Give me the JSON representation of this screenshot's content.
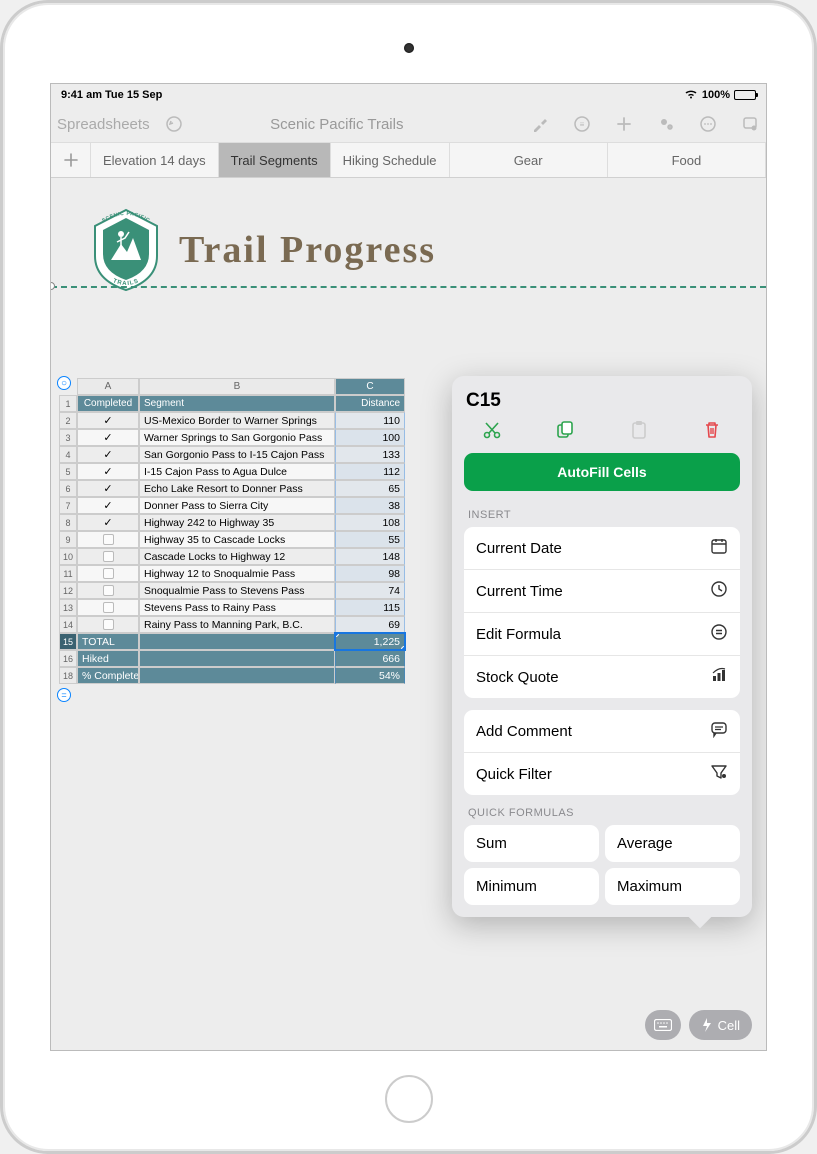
{
  "status": {
    "time_date": "9:41 am  Tue 15 Sep",
    "battery": "100%"
  },
  "toolbar": {
    "back": "Spreadsheets",
    "title": "Scenic Pacific Trails"
  },
  "tabs": [
    "Elevation 14 days",
    "Trail Segments",
    "Hiking Schedule",
    "Gear",
    "Food"
  ],
  "doc": {
    "title": "Trail Progress",
    "logo_upper": "SCENIC PACIFIC",
    "logo_lower": "TRAILS"
  },
  "spreadsheet": {
    "cols": [
      "A",
      "B",
      "C"
    ],
    "header": {
      "a": "Completed",
      "b": "Segment",
      "c": "Distance"
    },
    "rows": [
      {
        "n": "2",
        "done": true,
        "seg": "US-Mexico Border to Warner Springs",
        "dist": "110"
      },
      {
        "n": "3",
        "done": true,
        "seg": "Warner Springs to San Gorgonio Pass",
        "dist": "100"
      },
      {
        "n": "4",
        "done": true,
        "seg": "San Gorgonio Pass to I-15 Cajon Pass",
        "dist": "133"
      },
      {
        "n": "5",
        "done": true,
        "seg": "I-15 Cajon Pass to Agua Dulce",
        "dist": "112"
      },
      {
        "n": "6",
        "done": true,
        "seg": "Echo Lake Resort to Donner Pass",
        "dist": "65"
      },
      {
        "n": "7",
        "done": true,
        "seg": "Donner Pass to Sierra City",
        "dist": "38"
      },
      {
        "n": "8",
        "done": true,
        "seg": "Highway 242 to Highway 35",
        "dist": "108"
      },
      {
        "n": "9",
        "done": false,
        "seg": "Highway 35 to Cascade Locks",
        "dist": "55"
      },
      {
        "n": "10",
        "done": false,
        "seg": "Cascade Locks to Highway 12",
        "dist": "148"
      },
      {
        "n": "11",
        "done": false,
        "seg": "Highway 12 to Snoqualmie Pass",
        "dist": "98"
      },
      {
        "n": "12",
        "done": false,
        "seg": "Snoqualmie Pass to Stevens Pass",
        "dist": "74"
      },
      {
        "n": "13",
        "done": false,
        "seg": "Stevens Pass to Rainy Pass",
        "dist": "115"
      },
      {
        "n": "14",
        "done": false,
        "seg": "Rainy Pass to Manning Park, B.C.",
        "dist": "69"
      }
    ],
    "summary": [
      {
        "n": "15",
        "label": "TOTAL",
        "val": "1,225",
        "selected": true
      },
      {
        "n": "16",
        "label": "Hiked",
        "val": "666",
        "selected": false
      },
      {
        "n": "18",
        "label": "% Completed",
        "val": "54%",
        "selected": false
      }
    ]
  },
  "popover": {
    "cell_ref": "C15",
    "autofill": "AutoFill Cells",
    "insert_label": "INSERT",
    "insert": [
      {
        "label": "Current Date",
        "icon": "calendar"
      },
      {
        "label": "Current Time",
        "icon": "clock"
      },
      {
        "label": "Edit Formula",
        "icon": "equals"
      },
      {
        "label": "Stock Quote",
        "icon": "chart"
      }
    ],
    "utility": [
      {
        "label": "Add Comment",
        "icon": "comment"
      },
      {
        "label": "Quick Filter",
        "icon": "filter"
      }
    ],
    "formulas_label": "QUICK FORMULAS",
    "formulas": [
      "Sum",
      "Average",
      "Minimum",
      "Maximum"
    ]
  },
  "bottom": {
    "cell": "Cell"
  }
}
